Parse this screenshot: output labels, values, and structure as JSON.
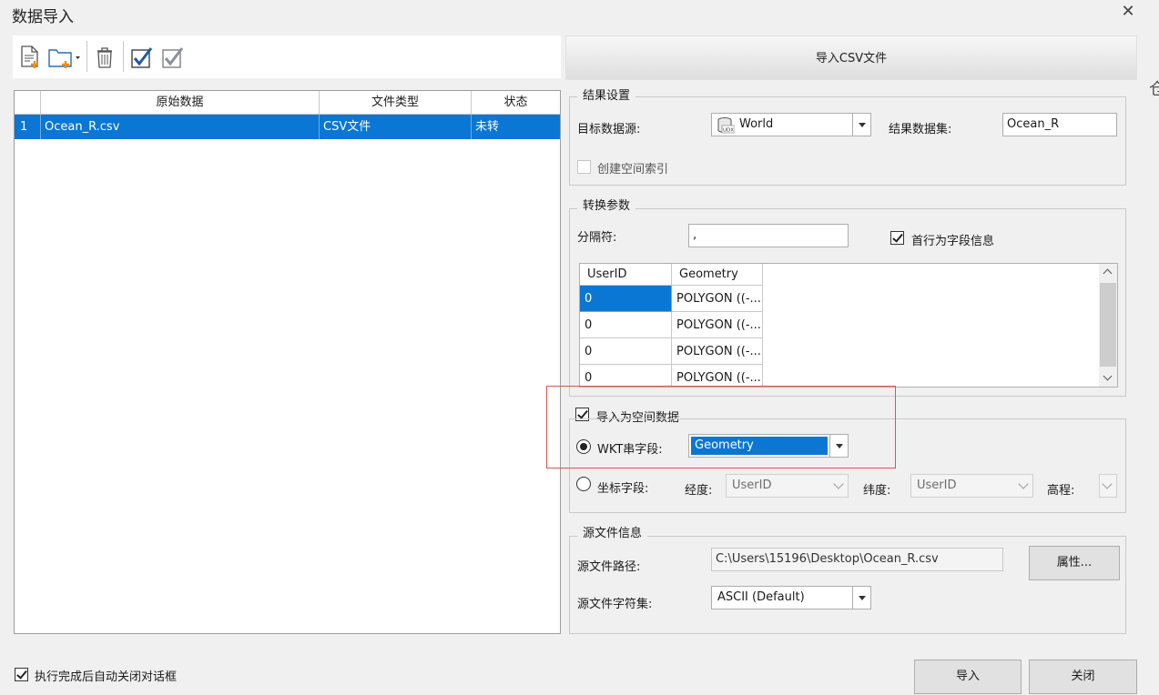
{
  "window": {
    "title": "数据导入"
  },
  "toolbar": {
    "icons": [
      "add-file-icon",
      "add-folder-icon",
      "delete-icon",
      "select-all-icon",
      "invert-select-icon"
    ]
  },
  "import_csv_label": "导入CSV文件",
  "left_grid": {
    "headers": [
      "原始数据",
      "文件类型",
      "状态"
    ],
    "rows": [
      {
        "index": "1",
        "name": "Ocean_R.csv",
        "type": "CSV文件",
        "status": "未转"
      }
    ]
  },
  "result_settings": {
    "title": "结果设置",
    "target_ds_label": "目标数据源:",
    "target_ds_value": "World",
    "target_ds_icon": "udbx-datasource-icon",
    "result_dataset_label": "结果数据集:",
    "result_dataset_value": "Ocean_R",
    "spatial_index_label": "创建空间索引"
  },
  "convert_params": {
    "title": "转换参数",
    "separator_label": "分隔符:",
    "separator_value": ",",
    "first_row_label": "首行为字段信息",
    "preview": {
      "headers": [
        "UserID",
        "Geometry"
      ],
      "rows": [
        [
          "0",
          "POLYGON ((-..."
        ],
        [
          "0",
          "POLYGON ((-..."
        ],
        [
          "0",
          "POLYGON ((-..."
        ],
        [
          "0",
          "POLYGON ((-..."
        ]
      ]
    }
  },
  "spatial_import": {
    "checkbox_label": "导入为空间数据",
    "wkt_label": "WKT串字段:",
    "wkt_value": "Geometry",
    "coord_label": "坐标字段:",
    "lon_label": "经度:",
    "lon_value": "UserID",
    "lat_label": "纬度:",
    "lat_value": "UserID",
    "elev_label": "高程:"
  },
  "source_info": {
    "title": "源文件信息",
    "path_label": "源文件路径:",
    "path_value": "C:\\Users\\15196\\Desktop\\Ocean_R.csv",
    "props_button": "属性...",
    "charset_label": "源文件字符集:",
    "charset_value": "ASCII (Default)"
  },
  "footer": {
    "auto_close_label": "执行完成后自动关闭对话框",
    "import_button": "导入",
    "close_button": "关闭"
  },
  "edge_glyph": "仓",
  "colors": {
    "selection": "#0a77d5",
    "highlight_frame": "#e05252"
  }
}
